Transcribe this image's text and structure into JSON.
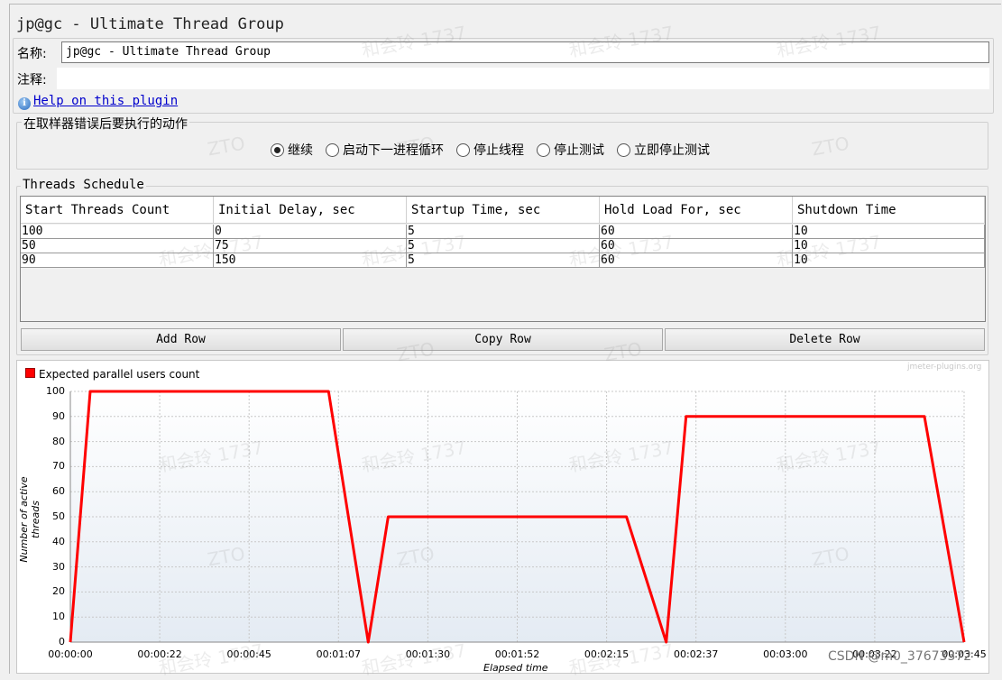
{
  "window": {
    "title": "jp@gc - Ultimate Thread Group"
  },
  "form": {
    "name_label": "名称:",
    "name_value": "jp@gc - Ultimate Thread Group",
    "comment_label": "注释:",
    "comment_value": "",
    "help_link": "Help on this plugin"
  },
  "error_action": {
    "title": "在取样器错误后要执行的动作",
    "options": [
      "继续",
      "启动下一进程循环",
      "停止线程",
      "停止测试",
      "立即停止测试"
    ],
    "selected_index": 0
  },
  "schedule": {
    "title": "Threads Schedule",
    "columns": [
      "Start Threads Count",
      "Initial Delay, sec",
      "Startup Time, sec",
      "Hold Load For, sec",
      "Shutdown Time"
    ],
    "rows": [
      [
        "100",
        "0",
        "5",
        "60",
        "10"
      ],
      [
        "50",
        "75",
        "5",
        "60",
        "10"
      ],
      [
        "90",
        "150",
        "5",
        "60",
        "10"
      ]
    ],
    "buttons": {
      "add": "Add Row",
      "copy": "Copy Row",
      "delete": "Delete Row"
    }
  },
  "chart_data": {
    "type": "line",
    "series": [
      {
        "name": "Expected parallel users count",
        "color": "#ff0000",
        "x": [
          0,
          5,
          65,
          75,
          80,
          80,
          140,
          150,
          155,
          155,
          215,
          225
        ],
        "y": [
          0,
          100,
          100,
          0,
          50,
          50,
          50,
          0,
          90,
          90,
          90,
          0
        ]
      }
    ],
    "ylabel": "Number of active threads",
    "xlabel": "Elapsed time",
    "ylim": [
      0,
      100
    ],
    "yticks": [
      "0",
      "10",
      "20",
      "30",
      "40",
      "50",
      "60",
      "70",
      "80",
      "90",
      "100"
    ],
    "xticks": [
      "00:00:00",
      "00:00:22",
      "00:00:45",
      "00:01:07",
      "00:01:30",
      "00:01:52",
      "00:02:15",
      "00:02:37",
      "00:03:00",
      "00:03:22",
      "00:03:45"
    ],
    "grid": true,
    "legend_position": "top-left",
    "brand": "jmeter-plugins.org"
  },
  "watermark": {
    "text": "和会玲 1737",
    "zto": "ZTO",
    "csdn": "CSDN @m0_37673372"
  }
}
